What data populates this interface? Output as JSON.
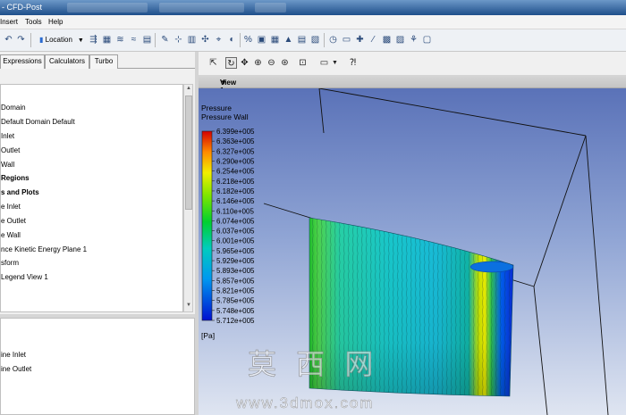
{
  "window": {
    "title": "- CFD-Post"
  },
  "menu": {
    "items": [
      "Insert",
      "Tools",
      "Help"
    ]
  },
  "toolbar": {
    "location_label": "Location"
  },
  "left_panel": {
    "tabs": [
      "Expressions",
      "Calculators",
      "Turbo"
    ],
    "tree": [
      {
        "label": "Domain",
        "bold": false
      },
      {
        "label": "Default Domain Default",
        "bold": false
      },
      {
        "label": "Inlet",
        "bold": false
      },
      {
        "label": "Outlet",
        "bold": false
      },
      {
        "label": "Wall",
        "bold": false
      },
      {
        "label": "Regions",
        "bold": true
      },
      {
        "label": "s and Plots",
        "bold": true
      },
      {
        "label": "e Inlet",
        "bold": false
      },
      {
        "label": "e Outlet",
        "bold": false
      },
      {
        "label": "e Wall",
        "bold": false
      },
      {
        "label": "nce Kinetic Energy Plane 1",
        "bold": false
      },
      {
        "label": "sform",
        "bold": false
      },
      {
        "label": "Legend View 1",
        "bold": false
      }
    ],
    "tree2": [
      {
        "label": "ine Inlet"
      },
      {
        "label": "ine Outlet"
      }
    ]
  },
  "viewer": {
    "view_label": "View 1",
    "view_caret": "▼",
    "legend": {
      "title": "Pressure",
      "subtitle": "Pressure Wall",
      "unit": "[Pa]",
      "values": [
        "6.399e+005",
        "6.363e+005",
        "6.327e+005",
        "6.290e+005",
        "6.254e+005",
        "6.218e+005",
        "6.182e+005",
        "6.146e+005",
        "6.110e+005",
        "6.074e+005",
        "6.037e+005",
        "6.001e+005",
        "5.965e+005",
        "5.929e+005",
        "5.893e+005",
        "5.857e+005",
        "5.821e+005",
        "5.785e+005",
        "5.748e+005",
        "5.712e+005"
      ],
      "colors": [
        "#d40000",
        "#f04000",
        "#ff7a00",
        "#ffa800",
        "#ffd000",
        "#f2ef00",
        "#c8ee00",
        "#96e800",
        "#5ee000",
        "#2ad800",
        "#00d228",
        "#00d06a",
        "#00d0a2",
        "#00cccc",
        "#00b4e4",
        "#0090f0",
        "#006ef4",
        "#0048f2",
        "#0028e8",
        "#0010d0"
      ]
    }
  },
  "watermark": {
    "chars": "莫 西 网",
    "url": "www.3dmox.com"
  }
}
